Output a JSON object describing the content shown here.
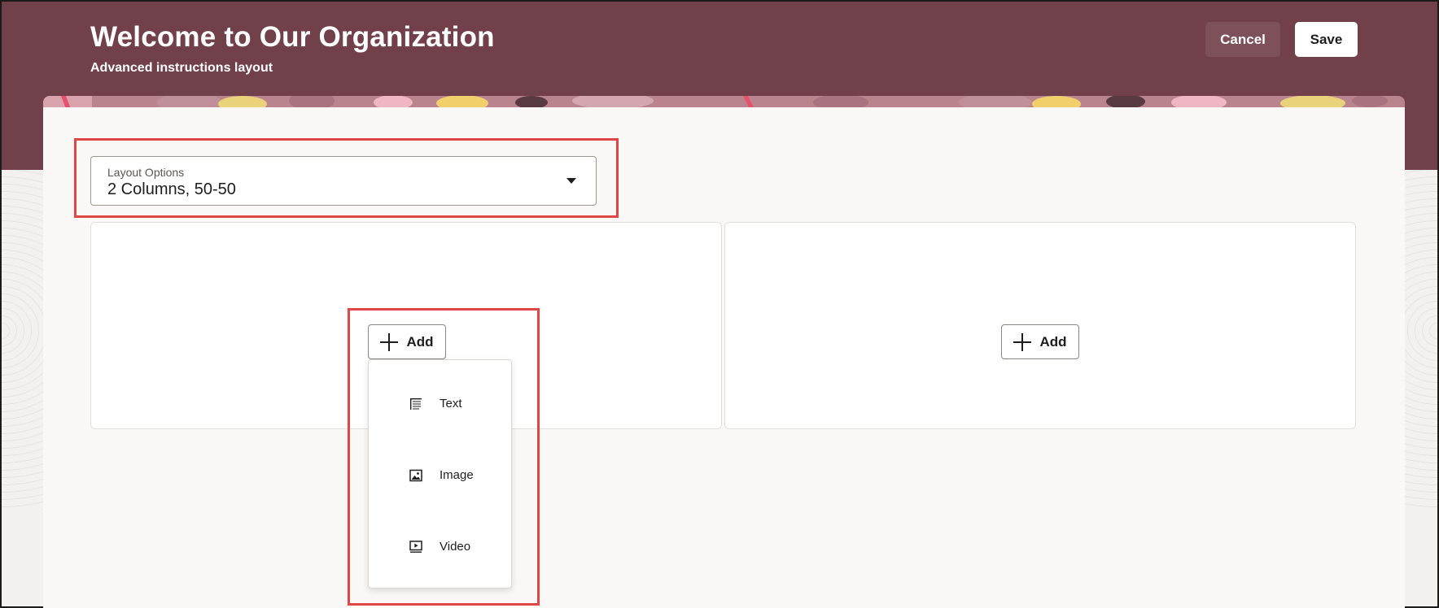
{
  "header": {
    "title": "Welcome to Our Organization",
    "subtitle": "Advanced instructions layout",
    "cancel_label": "Cancel",
    "save_label": "Save"
  },
  "layout_options": {
    "label": "Layout Options",
    "value": "2 Columns, 50-50"
  },
  "columns": [
    {
      "add_label": "Add"
    },
    {
      "add_label": "Add"
    }
  ],
  "add_menu": {
    "items": [
      {
        "label": "Text",
        "icon": "text-icon"
      },
      {
        "label": "Image",
        "icon": "image-icon"
      },
      {
        "label": "Video",
        "icon": "video-icon"
      }
    ]
  },
  "colors": {
    "header": "#71404b",
    "highlight": "#e04646",
    "card": "#f9f8f6"
  }
}
